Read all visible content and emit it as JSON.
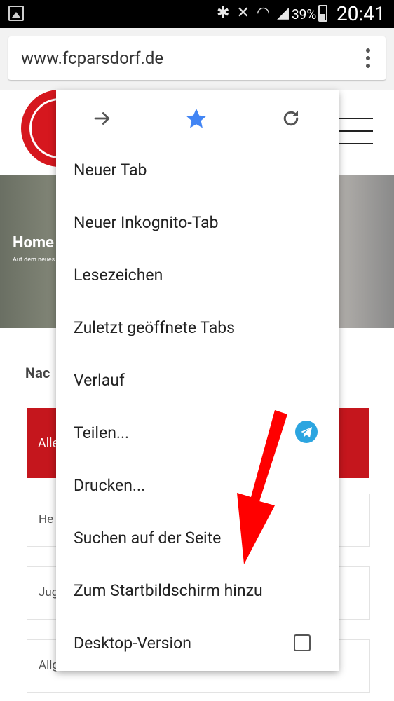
{
  "status_bar": {
    "battery_percent": "39%",
    "time": "20:41"
  },
  "browser": {
    "url": "www.fcparsdorf.de"
  },
  "website": {
    "hero_title": "Home",
    "hero_subtitle": "Auf dem neues",
    "news_heading": "Nac",
    "red_tab_label": "Alle",
    "categories": [
      "He",
      "Jug",
      "Allg"
    ]
  },
  "menu": {
    "actions": [
      "forward-icon",
      "star-icon",
      "refresh-icon"
    ],
    "items": [
      {
        "label": "Neuer Tab"
      },
      {
        "label": "Neuer Inkognito-Tab"
      },
      {
        "label": "Lesezeichen"
      },
      {
        "label": "Zuletzt geöffnete Tabs"
      },
      {
        "label": "Verlauf"
      },
      {
        "label": "Teilen..."
      },
      {
        "label": "Drucken..."
      },
      {
        "label": "Suchen auf der Seite"
      },
      {
        "label": "Zum Startbildschirm hinzu"
      },
      {
        "label": "Desktop-Version"
      }
    ],
    "accent_color": "#4285f4",
    "arrow_color": "#ff0000"
  }
}
